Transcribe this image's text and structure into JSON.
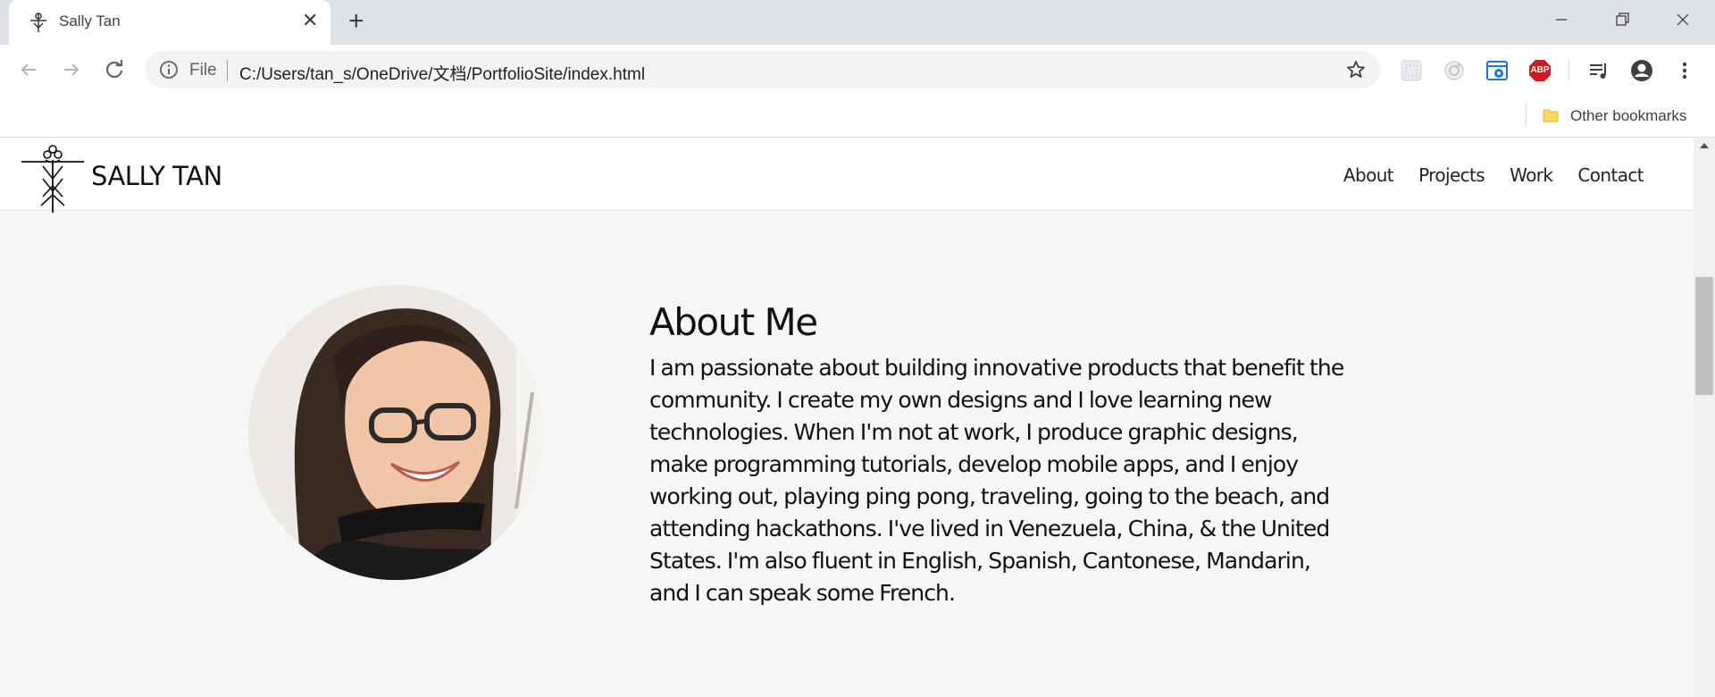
{
  "browser": {
    "tab_title": "Sally Tan",
    "new_tab_symbol": "+",
    "close_symbol": "✕",
    "scheme_label": "File",
    "url": "C:/Users/tan_s/OneDrive/文档/PortfolioSite/index.html",
    "bookmarks_label": "Other bookmarks",
    "extensions": [
      "screenshot-icon",
      "camera-icon",
      "capture-icon",
      "adblock-icon"
    ],
    "adblock_text": "ABP"
  },
  "site": {
    "brand": "SALLY TAN",
    "nav": [
      "About",
      "Projects",
      "Work",
      "Contact"
    ],
    "about_title": "About Me",
    "about_body": "I am passionate about building innovative products that benefit the community. I create my own designs and I love learning new technologies. When I'm not at work, I produce graphic designs, make programming tutorials, develop mobile apps, and I enjoy working out, playing ping pong, traveling, going to the beach, and attending hackathons. I've lived in Venezuela, China, & the United States. I'm also fluent in English, Spanish, Cantonese, Mandarin, and I can speak some French."
  },
  "colors": {
    "chrome_bg": "#dee1e6",
    "omnibox_bg": "#f1f3f4",
    "page_bg": "#f6f6f6",
    "abp_red": "#d11a1f",
    "capture_blue": "#1a73e8"
  }
}
